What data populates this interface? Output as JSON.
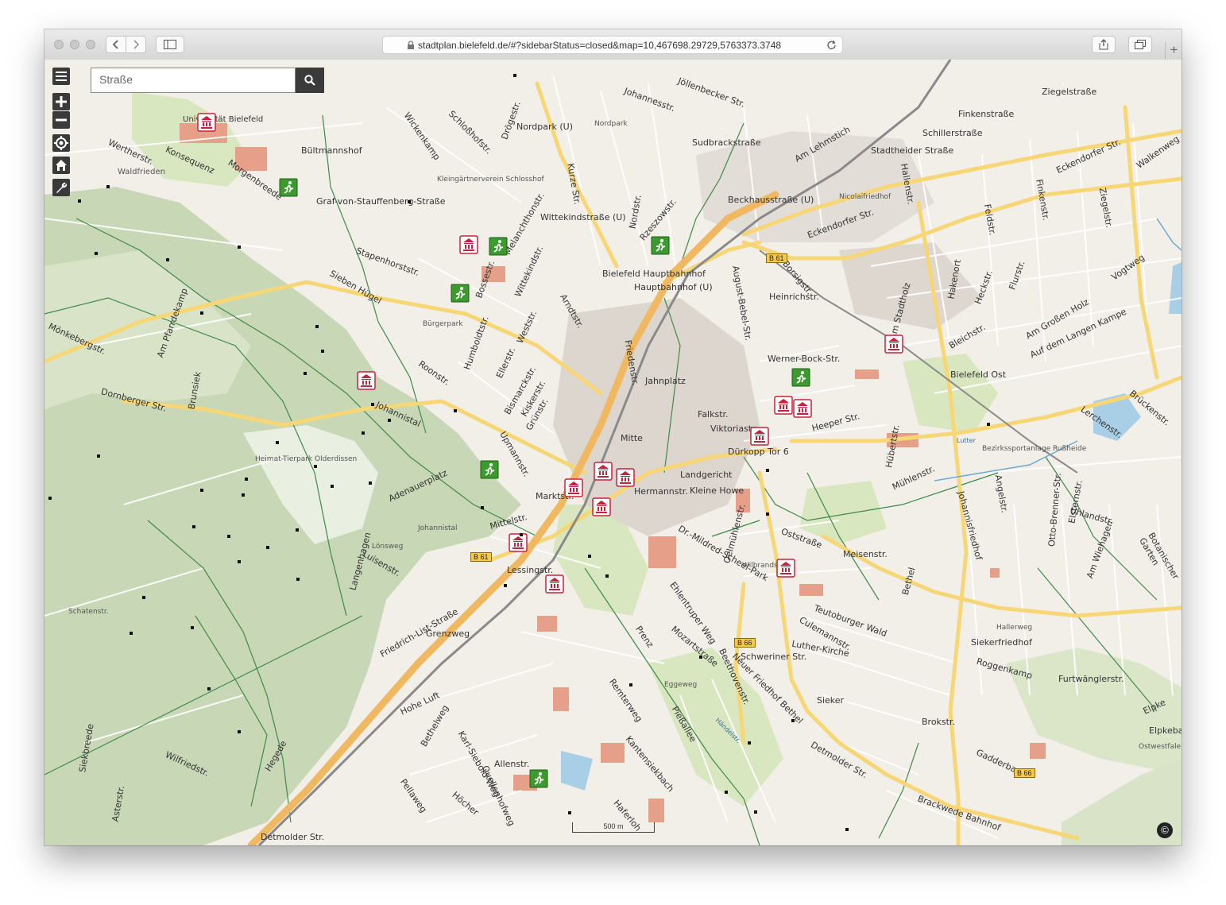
{
  "browser": {
    "url": "stadtplan.bielefeld.de/#?sidebarStatus=closed&map=10,467698.29729,5763373.3748"
  },
  "map": {
    "search": {
      "placeholder": "Straße"
    },
    "scale_label": "500 m",
    "copyright_symbol": "©",
    "controls": [
      "menu-icon",
      "zoom-in-icon",
      "zoom-out-icon",
      "locate-icon",
      "home-icon",
      "wrench-icon"
    ],
    "colors": {
      "background": "#f2efe9",
      "road_major": "#f7d775",
      "motorway": "#f0b860",
      "forest": "#c8d7b5",
      "park": "#d9e7c0",
      "water": "#a9cfe6",
      "building_red": "#e6a08a",
      "path_green": "#3f8a4a",
      "museum_marker": "#c8203c",
      "sport_marker": "#3c9a2e",
      "rail": "#8a8a8a"
    },
    "labels": [
      "Universität Bielefeld",
      "Konsequenz",
      "Wertherstr.",
      "Morgenbreede",
      "Waldfrieden",
      "Bültmannshof",
      "Wickenkamp",
      "Schloßhofstr.",
      "Drögestr.",
      "Nordpark (U)",
      "Nordpark",
      "Johannesstr.",
      "Jöllenbecker Str.",
      "Sudbrackstraße",
      "Am Lehmstich",
      "Stadtheider Straße",
      "Schillerstraße",
      "Ziegelstraße",
      "Finkenstraße",
      "Eckendorfer Str.",
      "Walkenweg",
      "Graf-von-Stauffenberg-Straße",
      "Kleingärtnerverein Schlosshof",
      "Melanchthonstr.",
      "Wittekindstraße (U)",
      "Kurze Str.",
      "Nordstr.",
      "Beckhausstraße (U)",
      "Nicolaifriedhof",
      "Hallenstr.",
      "Finkenstr.",
      "Feldstr.",
      "Ziegelstr.",
      "Stapenhorststr.",
      "Rzeszowstr.",
      "Eckendorfer Str.",
      "Sieben Hügel",
      "Bossestr.",
      "Wittekindstr.",
      "Bielefeld Hauptbahnhof",
      "Hauptbahnhof (U)",
      "August-Bebel-Str.",
      "Heinrichstr.",
      "Borsigstr.",
      "Am Stadtholz",
      "Hakenort",
      "Heckstr.",
      "Flurstr.",
      "Am Großen Holz",
      "Vogtweg",
      "Auf dem Langen Kampe",
      "Bürgerpark",
      "Humboldtstr.",
      "Weststr.",
      "Arndtstr.",
      "Friedenstr.",
      "Bleichstr.",
      "Bielefeld Ost",
      "Mönkebergstr.",
      "Am Pfarrdekamp",
      "Brunsiek",
      "Roonstr.",
      "Ellerstr.",
      "Bismarckstr.",
      "Werner-Bock-Str.",
      "Jahnplatz",
      "Dornberger Str.",
      "Johannistal",
      "Kiskerstr.",
      "Grünstr.",
      "Falkstr.",
      "Viktoriastr.",
      "Heeper Str.",
      "Hübertstr.",
      "Lutter",
      "Bezirkssportanlage Rußheide",
      "Brückenstr.",
      "Lerchenstr.",
      "Heimat-Tierpark Olderdissen",
      "Upmannstr.",
      "Mitte",
      "Dürkopp Tor 6",
      "Mühlenstr.",
      "Angelstr.",
      "Otto-Brenner-Str.",
      "Elsternstr.",
      "Uhlandstr.",
      "Adenauerplatz",
      "Marktstr.",
      "Landgericht",
      "Hermannstr.",
      "Kleine Howe",
      "Johannisfriedhof",
      "Johannistal",
      "Mittelstr.",
      "Oelmühlenstr.",
      "Oststraße",
      "Meisenstr.",
      "Am Wiehagen",
      "Botanischer Garten",
      "Lönsweg",
      "Langenhagen",
      "Luisenstr.",
      "Dr.-Mildred-Scheel-Park",
      "Wilbrandstr.",
      "Bethel",
      "Lessingstr.",
      "Ehlentruper Weg",
      "Teutoburger Wald",
      "Schatenstr.",
      "Culemannstr.",
      "Luther-Kirche",
      "Siekerfriedhof",
      "Hallerweg",
      "Friedrich-List-Straße",
      "Grenzweg",
      "Prenz",
      "Mozartstraße",
      "Schweriner Str.",
      "Roggenkamp",
      "Furtwänglerstr.",
      "Beethovenstr.",
      "Neuer Friedhof Bethel",
      "Eggeweg",
      "Hohe Luft",
      "Bethelweg",
      "Remterweg",
      "Pießallee",
      "Sieker",
      "Brokstr.",
      "Elpke",
      "Elpkebachtal",
      "Ostwestfalendamm",
      "Hegede",
      "Karl-Siebold-Weg",
      "Kantensiekbach",
      "Händelstr.",
      "Detmolder Str.",
      "Gadderbaum",
      "Allenstr.",
      "Siekbreede",
      "Wilfriedstr.",
      "Asterstr.",
      "Pellaweg",
      "Höcher",
      "Quellenhofweg",
      "Haferloh",
      "Brackwede Bahnhof",
      "Detmolder Str."
    ],
    "shields": [
      "B 61",
      "B 61",
      "B 66",
      "B 66"
    ]
  }
}
